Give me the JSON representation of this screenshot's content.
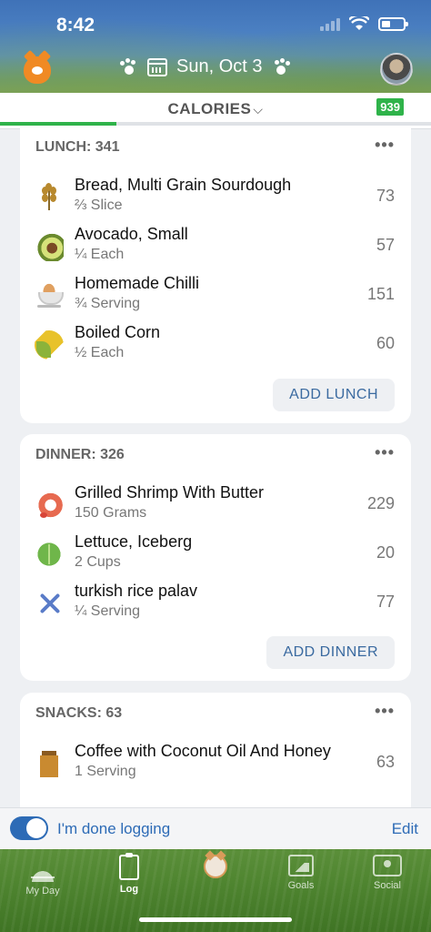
{
  "status": {
    "time": "8:42"
  },
  "header": {
    "date": "Sun, Oct 3"
  },
  "calories": {
    "label": "CALORIES",
    "remaining": "939",
    "progress_fraction": 0.27
  },
  "lunch": {
    "title": "LUNCH: 341",
    "items": [
      {
        "name": "Bread, Multi Grain Sourdough",
        "serving": "⅔ Slice",
        "kcal": "73",
        "icon": "wheat-icon"
      },
      {
        "name": "Avocado, Small",
        "serving": "¼ Each",
        "kcal": "57",
        "icon": "avocado-icon"
      },
      {
        "name": "Homemade Chilli",
        "serving": "¾ Serving",
        "kcal": "151",
        "icon": "bowl-icon"
      },
      {
        "name": "Boiled Corn",
        "serving": "½ Each",
        "kcal": "60",
        "icon": "corn-icon"
      }
    ],
    "add_label": "ADD LUNCH"
  },
  "dinner": {
    "title": "DINNER: 326",
    "items": [
      {
        "name": "Grilled Shrimp With Butter",
        "serving": "150 Grams",
        "kcal": "229",
        "icon": "shrimp-icon"
      },
      {
        "name": "Lettuce, Iceberg",
        "serving": "2 Cups",
        "kcal": "20",
        "icon": "lettuce-icon"
      },
      {
        "name": "turkish rice palav",
        "serving": "¼ Serving",
        "kcal": "77",
        "icon": "fork-knife-icon"
      }
    ],
    "add_label": "ADD DINNER"
  },
  "snacks": {
    "title": "SNACKS: 63",
    "items": [
      {
        "name": "Coffee with Coconut Oil And Honey",
        "serving": "1 Serving",
        "kcal": "63",
        "icon": "jar-icon"
      }
    ]
  },
  "done_bar": {
    "label": "I'm done logging",
    "edit": "Edit",
    "toggle_on": true
  },
  "tabs": [
    {
      "label": "My Day",
      "icon": "sunrise-icon"
    },
    {
      "label": "Log",
      "icon": "clipboard-icon",
      "active": true
    },
    {
      "label": "",
      "icon": "cat-icon"
    },
    {
      "label": "Goals",
      "icon": "goals-icon"
    },
    {
      "label": "Social",
      "icon": "social-icon"
    }
  ],
  "colors": {
    "accent_blue": "#2d6bb6",
    "green": "#2fb34a"
  }
}
